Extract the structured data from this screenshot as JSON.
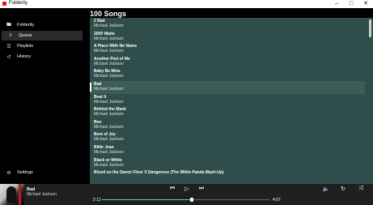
{
  "window": {
    "title": "Folderity"
  },
  "sidebar": {
    "items": [
      {
        "label": "Folderity",
        "icon": "folder-icon"
      },
      {
        "label": "Queue",
        "icon": "queue-icon"
      },
      {
        "label": "Playlists",
        "icon": "playlist-icon"
      },
      {
        "label": "History",
        "icon": "history-icon"
      }
    ],
    "settings_label": "Settings"
  },
  "main": {
    "title": "100 Songs"
  },
  "songs": [
    {
      "title": "2 Bad",
      "artist": "Michael Jackson"
    },
    {
      "title": "2000 Watts",
      "artist": "Michael Jackson"
    },
    {
      "title": "A Place With No Name",
      "artist": "Michael Jackson"
    },
    {
      "title": "Another Part of Me",
      "artist": "Michael Jackson"
    },
    {
      "title": "Baby Be Mine",
      "artist": "Michael Jackson"
    },
    {
      "title": "Bad",
      "artist": "Michael Jackson"
    },
    {
      "title": "Beat It",
      "artist": "Michael Jackson"
    },
    {
      "title": "Behind the Mask",
      "artist": "Michael Jackson"
    },
    {
      "title": "Ben",
      "artist": "Michael Jackson"
    },
    {
      "title": "Best of Joy",
      "artist": "Michael Jackson"
    },
    {
      "title": "Billie Jean",
      "artist": "Michael Jackson"
    },
    {
      "title": "Black or White",
      "artist": "Michael Jackson"
    },
    {
      "title": "Blood on the Dance Floor X Dangerous (The White Panda Mash-Up)",
      "artist": ""
    }
  ],
  "selected_index": 5,
  "player": {
    "title": "Bad",
    "artist": "Michael Jackson",
    "elapsed": "2:12",
    "duration": "4:07",
    "progress_fraction": 0.534
  },
  "colors": {
    "list_bg": "#2f4d4a",
    "accent": "#5fd3b4"
  }
}
